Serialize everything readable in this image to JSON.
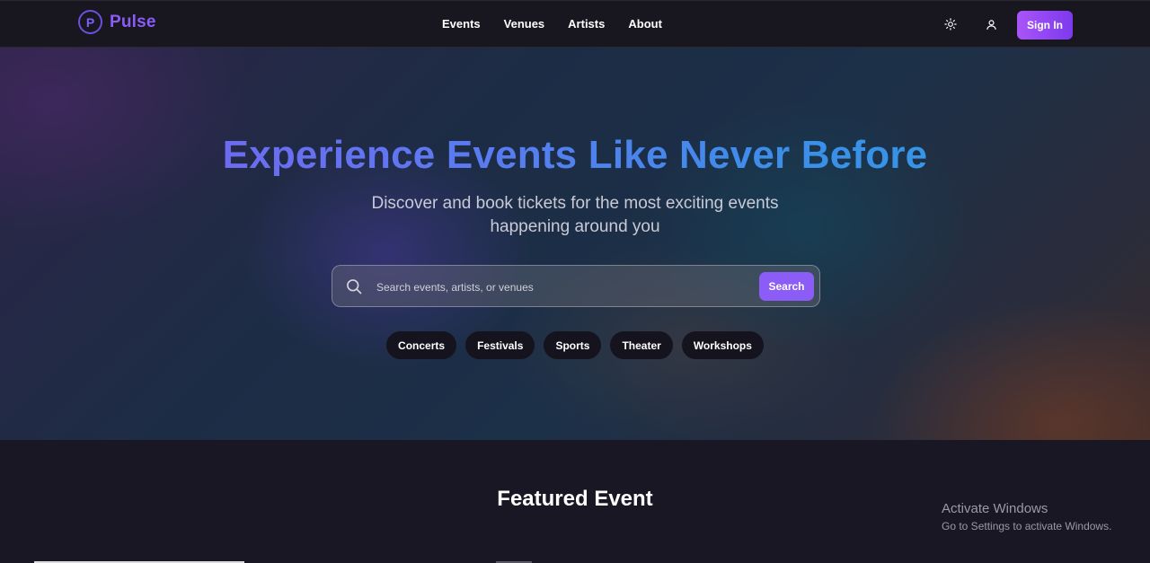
{
  "brand": {
    "logo_letter": "P",
    "name": "Pulse"
  },
  "nav": {
    "links": [
      "Events",
      "Venues",
      "Artists",
      "About"
    ],
    "sign_in_label": "Sign In"
  },
  "hero": {
    "title": "Experience Events Like Never Before",
    "subtitle": "Discover and book tickets for the most exciting events happening around you",
    "search": {
      "placeholder": "Search events, artists, or venues",
      "button_label": "Search"
    },
    "categories": [
      "Concerts",
      "Festivals",
      "Sports",
      "Theater",
      "Workshops"
    ]
  },
  "featured": {
    "title": "Featured Event"
  },
  "watermark": {
    "title": "Activate Windows",
    "subtitle": "Go to Settings to activate Windows."
  },
  "colors": {
    "accent": "#8b5cf6",
    "nav_bg": "#18161f",
    "page_bg": "#1a1724"
  },
  "icons": [
    "theme-toggle-sun-icon",
    "user-icon",
    "search-icon"
  ]
}
